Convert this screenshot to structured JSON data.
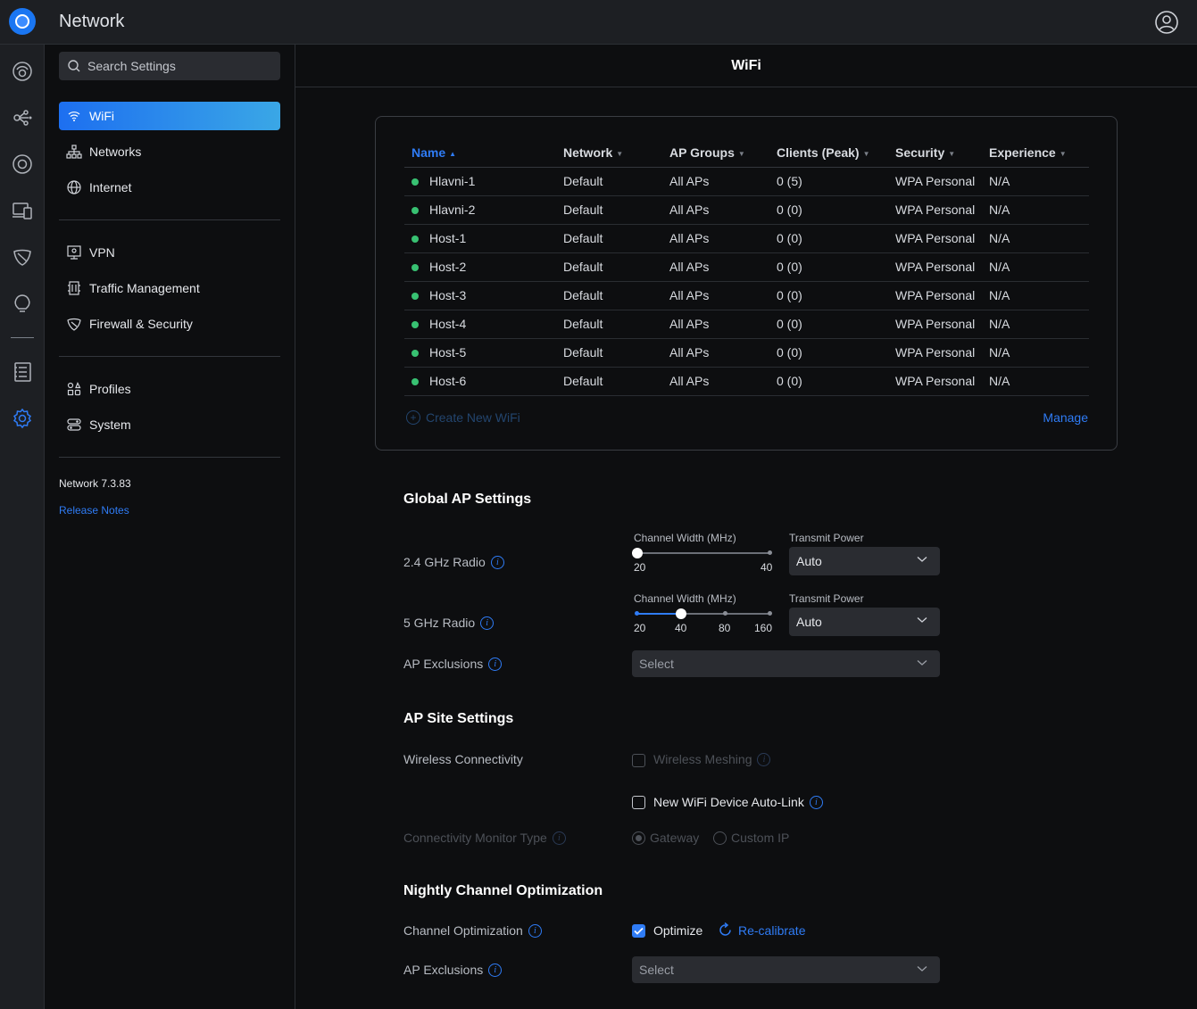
{
  "app": {
    "title": "Network"
  },
  "icons": {
    "logo": "ubiquiti-logo-icon",
    "user": "user-account-icon",
    "rail": [
      "dashboard-icon",
      "topology-icon",
      "devices-icon",
      "clients-icon",
      "insights-icon",
      "alerts-icon",
      "logs-icon",
      "settings-icon"
    ]
  },
  "sidebar": {
    "search_placeholder": "Search Settings",
    "groups": [
      [
        {
          "label": "WiFi",
          "icon": "wifi-icon",
          "active": true
        },
        {
          "label": "Networks",
          "icon": "networks-icon"
        },
        {
          "label": "Internet",
          "icon": "globe-icon"
        }
      ],
      [
        {
          "label": "VPN",
          "icon": "vpn-icon"
        },
        {
          "label": "Traffic Management",
          "icon": "traffic-icon"
        },
        {
          "label": "Firewall & Security",
          "icon": "shield-icon"
        }
      ],
      [
        {
          "label": "Profiles",
          "icon": "profiles-icon"
        },
        {
          "label": "System",
          "icon": "system-icon"
        }
      ]
    ],
    "version": "Network 7.3.83",
    "release_notes": "Release Notes"
  },
  "main": {
    "header": "WiFi",
    "wifi_table": {
      "columns": [
        "Name",
        "Network",
        "AP Groups",
        "Clients (Peak)",
        "Security",
        "Experience"
      ],
      "rows": [
        [
          "Hlavni-1",
          "Default",
          "All APs",
          "0 (5)",
          "WPA Personal",
          "N/A"
        ],
        [
          "Hlavni-2",
          "Default",
          "All APs",
          "0 (0)",
          "WPA Personal",
          "N/A"
        ],
        [
          "Host-1",
          "Default",
          "All APs",
          "0 (0)",
          "WPA Personal",
          "N/A"
        ],
        [
          "Host-2",
          "Default",
          "All APs",
          "0 (0)",
          "WPA Personal",
          "N/A"
        ],
        [
          "Host-3",
          "Default",
          "All APs",
          "0 (0)",
          "WPA Personal",
          "N/A"
        ],
        [
          "Host-4",
          "Default",
          "All APs",
          "0 (0)",
          "WPA Personal",
          "N/A"
        ],
        [
          "Host-5",
          "Default",
          "All APs",
          "0 (0)",
          "WPA Personal",
          "N/A"
        ],
        [
          "Host-6",
          "Default",
          "All APs",
          "0 (0)",
          "WPA Personal",
          "N/A"
        ]
      ],
      "create_new": "Create New WiFi",
      "manage": "Manage"
    },
    "global_ap": {
      "title": "Global AP Settings",
      "radio24": {
        "label": "2.4 GHz Radio",
        "width_caption": "Channel Width (MHz)",
        "ticks": [
          "20",
          "40"
        ],
        "selected": "20",
        "power_caption": "Transmit Power",
        "power": "Auto"
      },
      "radio5": {
        "label": "5 GHz Radio",
        "width_caption": "Channel Width (MHz)",
        "ticks": [
          "20",
          "40",
          "80",
          "160"
        ],
        "selected": "40",
        "power_caption": "Transmit Power",
        "power": "Auto"
      },
      "exclusions": {
        "label": "AP Exclusions",
        "placeholder": "Select"
      }
    },
    "site": {
      "title": "AP Site Settings",
      "wireless_label": "Wireless Connectivity",
      "meshing": {
        "label": "Wireless Meshing",
        "checked": false,
        "disabled": true
      },
      "autolink": {
        "label": "New WiFi Device Auto-Link",
        "checked": false
      },
      "monitor": {
        "label": "Connectivity Monitor Type",
        "options": [
          "Gateway",
          "Custom IP"
        ],
        "selected": "Gateway"
      }
    },
    "nightly": {
      "title": "Nightly Channel Optimization",
      "label": "Channel Optimization",
      "optimize": {
        "label": "Optimize",
        "checked": true
      },
      "recalibrate": "Re-calibrate",
      "exclusions": {
        "label": "AP Exclusions",
        "placeholder": "Select"
      }
    }
  },
  "colors": {
    "accent": "#2f7cf6",
    "status_ok": "#38c172",
    "bg": "#0d0e10",
    "panel": "#1d1f23"
  }
}
